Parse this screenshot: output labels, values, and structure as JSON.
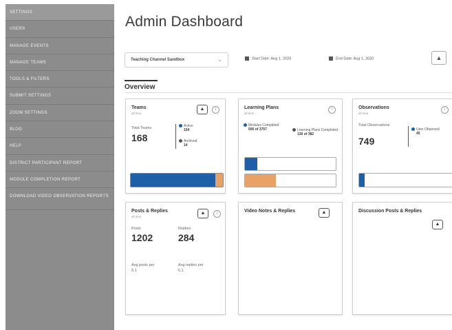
{
  "sidebar": {
    "items": [
      {
        "label": "SETTINGS"
      },
      {
        "label": "USERS"
      },
      {
        "label": "MANAGE EVENTS"
      },
      {
        "label": "MANAGE TEAMS"
      },
      {
        "label": "TOOLS & FILTERS"
      },
      {
        "label": "SUBMIT SETTINGS"
      },
      {
        "label": "ZOOM SETTINGS"
      },
      {
        "label": "BLOG"
      },
      {
        "label": "HELP"
      },
      {
        "label": "DISTRICT PARTICIPANT REPORT"
      },
      {
        "label": "MODULE COMPLETION REPORT"
      },
      {
        "label": "DOWNLOAD VIDEO OBSERVATION REPORTS"
      }
    ]
  },
  "header": {
    "title": "Admin Dashboard",
    "filter_select": "Teaching Channel Sandbox",
    "date_start": "Start Date: Aug 1, 2020",
    "date_end": "End Date: Aug 1, 2020",
    "export_icon": "upload-icon"
  },
  "tabs": {
    "active": "Overview"
  },
  "cards": {
    "teams": {
      "title": "Teams",
      "sub": "all time",
      "total_label": "Total Teams",
      "total_value": "168",
      "active_label": "Active",
      "active_value": "154",
      "archived_label": "Archived",
      "archived_value": "14",
      "active_fraction": 0.917,
      "colors": {
        "active": "#1f5fa8",
        "archived": "#e8a267"
      }
    },
    "learning_plans": {
      "title": "Learning Plans",
      "sub": "all time",
      "modules_label": "Modules Completed",
      "modules_value": "506 of 3757",
      "plans_label": "Learning Plans Completed",
      "plans_value": "130 of 382",
      "modules_fraction": 0.135,
      "plans_fraction": 0.34,
      "colors": {
        "modules": "#1f5fa8",
        "plans": "#e8a267"
      }
    },
    "observations": {
      "title": "Observations",
      "sub": "all time",
      "total_label": "Total Observations",
      "total_value": "749",
      "user_label": "User Observed",
      "user_value": "45",
      "fraction": 0.06,
      "color": "#1f5fa8"
    },
    "posts": {
      "title": "Posts & Replies",
      "sub": "all time",
      "posts_label": "Posts",
      "posts_value": "1202",
      "replies_label": "Replies",
      "replies_value": "284",
      "avg_posts_label": "Avg posts per",
      "avg_posts_value": "5.1",
      "avg_replies_label": "Avg replies per",
      "avg_replies_value": "5.1"
    },
    "video_notes": {
      "title": "Video Notes & Replies"
    },
    "discussion": {
      "title": "Discussion Posts & Replies"
    }
  }
}
